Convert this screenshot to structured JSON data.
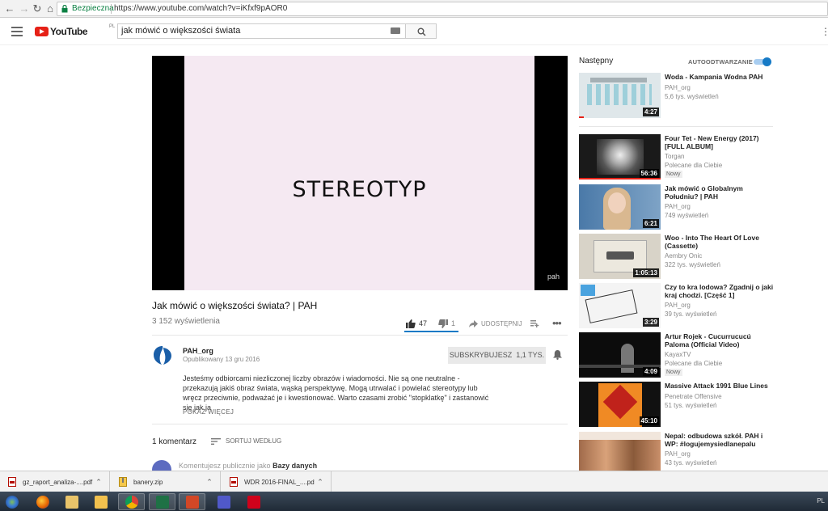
{
  "browser": {
    "secure_label": "Bezpieczna",
    "url": "https://www.youtube.com/watch?v=iKfxf9pAOR0"
  },
  "header": {
    "logo_text": "YouTube",
    "country_code": "PL",
    "search_value": "jak mówić o większości świata"
  },
  "player": {
    "frame_text": "STEREOTYP",
    "watermark": "pah"
  },
  "video": {
    "title": "Jak mówić o większości świata? | PAH",
    "views": "3 152 wyświetlenia",
    "likes": "47",
    "dislikes": "1",
    "share_label": "UDOSTĘPNIJ"
  },
  "channel": {
    "name": "PAH_org",
    "published": "Opublikowany 13 gru 2016",
    "subscribe_label": "SUBSKRYBUJESZ",
    "subscriber_count": "1,1 TYS."
  },
  "description": {
    "text": "Jesteśmy odbiorcami niezliczonej liczby obrazów i wiadomości. Nie są one neutralne - przekazują jakiś obraz świata, wąską perspektywę. Mogą utrwalać i powielać stereotypy lub wręcz przeciwnie, podważać je i kwestionować. Warto czasami zrobić \"stopklatkę\" i zastanowić się jak ja",
    "show_more": "POKAŻ WIĘCEJ"
  },
  "comments": {
    "count_label": "1 komentarz",
    "sort_label": "SORTUJ WEDŁUG",
    "placeholder_prefix": "Komentujesz publicznie jako",
    "placeholder_name": "Bazy danych"
  },
  "sidebar": {
    "next_label": "Następny",
    "autoplay_label": "AUTOODTWARZANIE",
    "autoplay_on": true,
    "items": [
      {
        "title": "Woda - Kampania Wodna PAH",
        "channel": "PAH_org",
        "views": "5,6 tys. wyświetleń",
        "duration": "4:27",
        "badge": ""
      },
      {
        "title": "Four Tet - New Energy (2017) [FULL ALBUM]",
        "channel": "Torgan",
        "views": "Polecane dla Ciebie",
        "duration": "56:36",
        "badge": "Nowy"
      },
      {
        "title": "Jak mówić o Globalnym Południu? | PAH",
        "channel": "PAH_org",
        "views": "749 wyświetleń",
        "duration": "6:21",
        "badge": ""
      },
      {
        "title": "Woo - Into The Heart Of Love (Cassette)",
        "channel": "Aembry Onic",
        "views": "322 tys. wyświetleń",
        "duration": "1:05:13",
        "badge": ""
      },
      {
        "title": "Czy to kra lodowa? Zgadnij o jaki kraj chodzi. [Część 1]",
        "channel": "PAH_org",
        "views": "39 tys. wyświetleń",
        "duration": "3:29",
        "badge": ""
      },
      {
        "title": "Artur Rojek - Cucurrucucú Paloma (Official Video)",
        "channel": "KayaxTV",
        "views": "Polecane dla Ciebie",
        "duration": "4:09",
        "badge": "Nowy"
      },
      {
        "title": "Massive Attack 1991 Blue Lines",
        "channel": "Penetrate Offensive",
        "views": "51 tys. wyświetleń",
        "duration": "45:10",
        "badge": ""
      },
      {
        "title": "Nepal: odbudowa szkół. PAH i WP: #logujemysiedlanepalu",
        "channel": "PAH_org",
        "views": "43 tys. wyświetleń",
        "duration": "",
        "badge": ""
      }
    ]
  },
  "downloads": [
    {
      "name": "gz_raport_analiza-....pdf"
    },
    {
      "name": "banery.zip"
    },
    {
      "name": "WDR 2016-FINAL_....pdf"
    }
  ],
  "taskbar": {
    "lang": "PL"
  },
  "colors": {
    "youtube_red": "#e62117",
    "accent_blue": "#167ac6",
    "secure_green": "#0b8043"
  }
}
